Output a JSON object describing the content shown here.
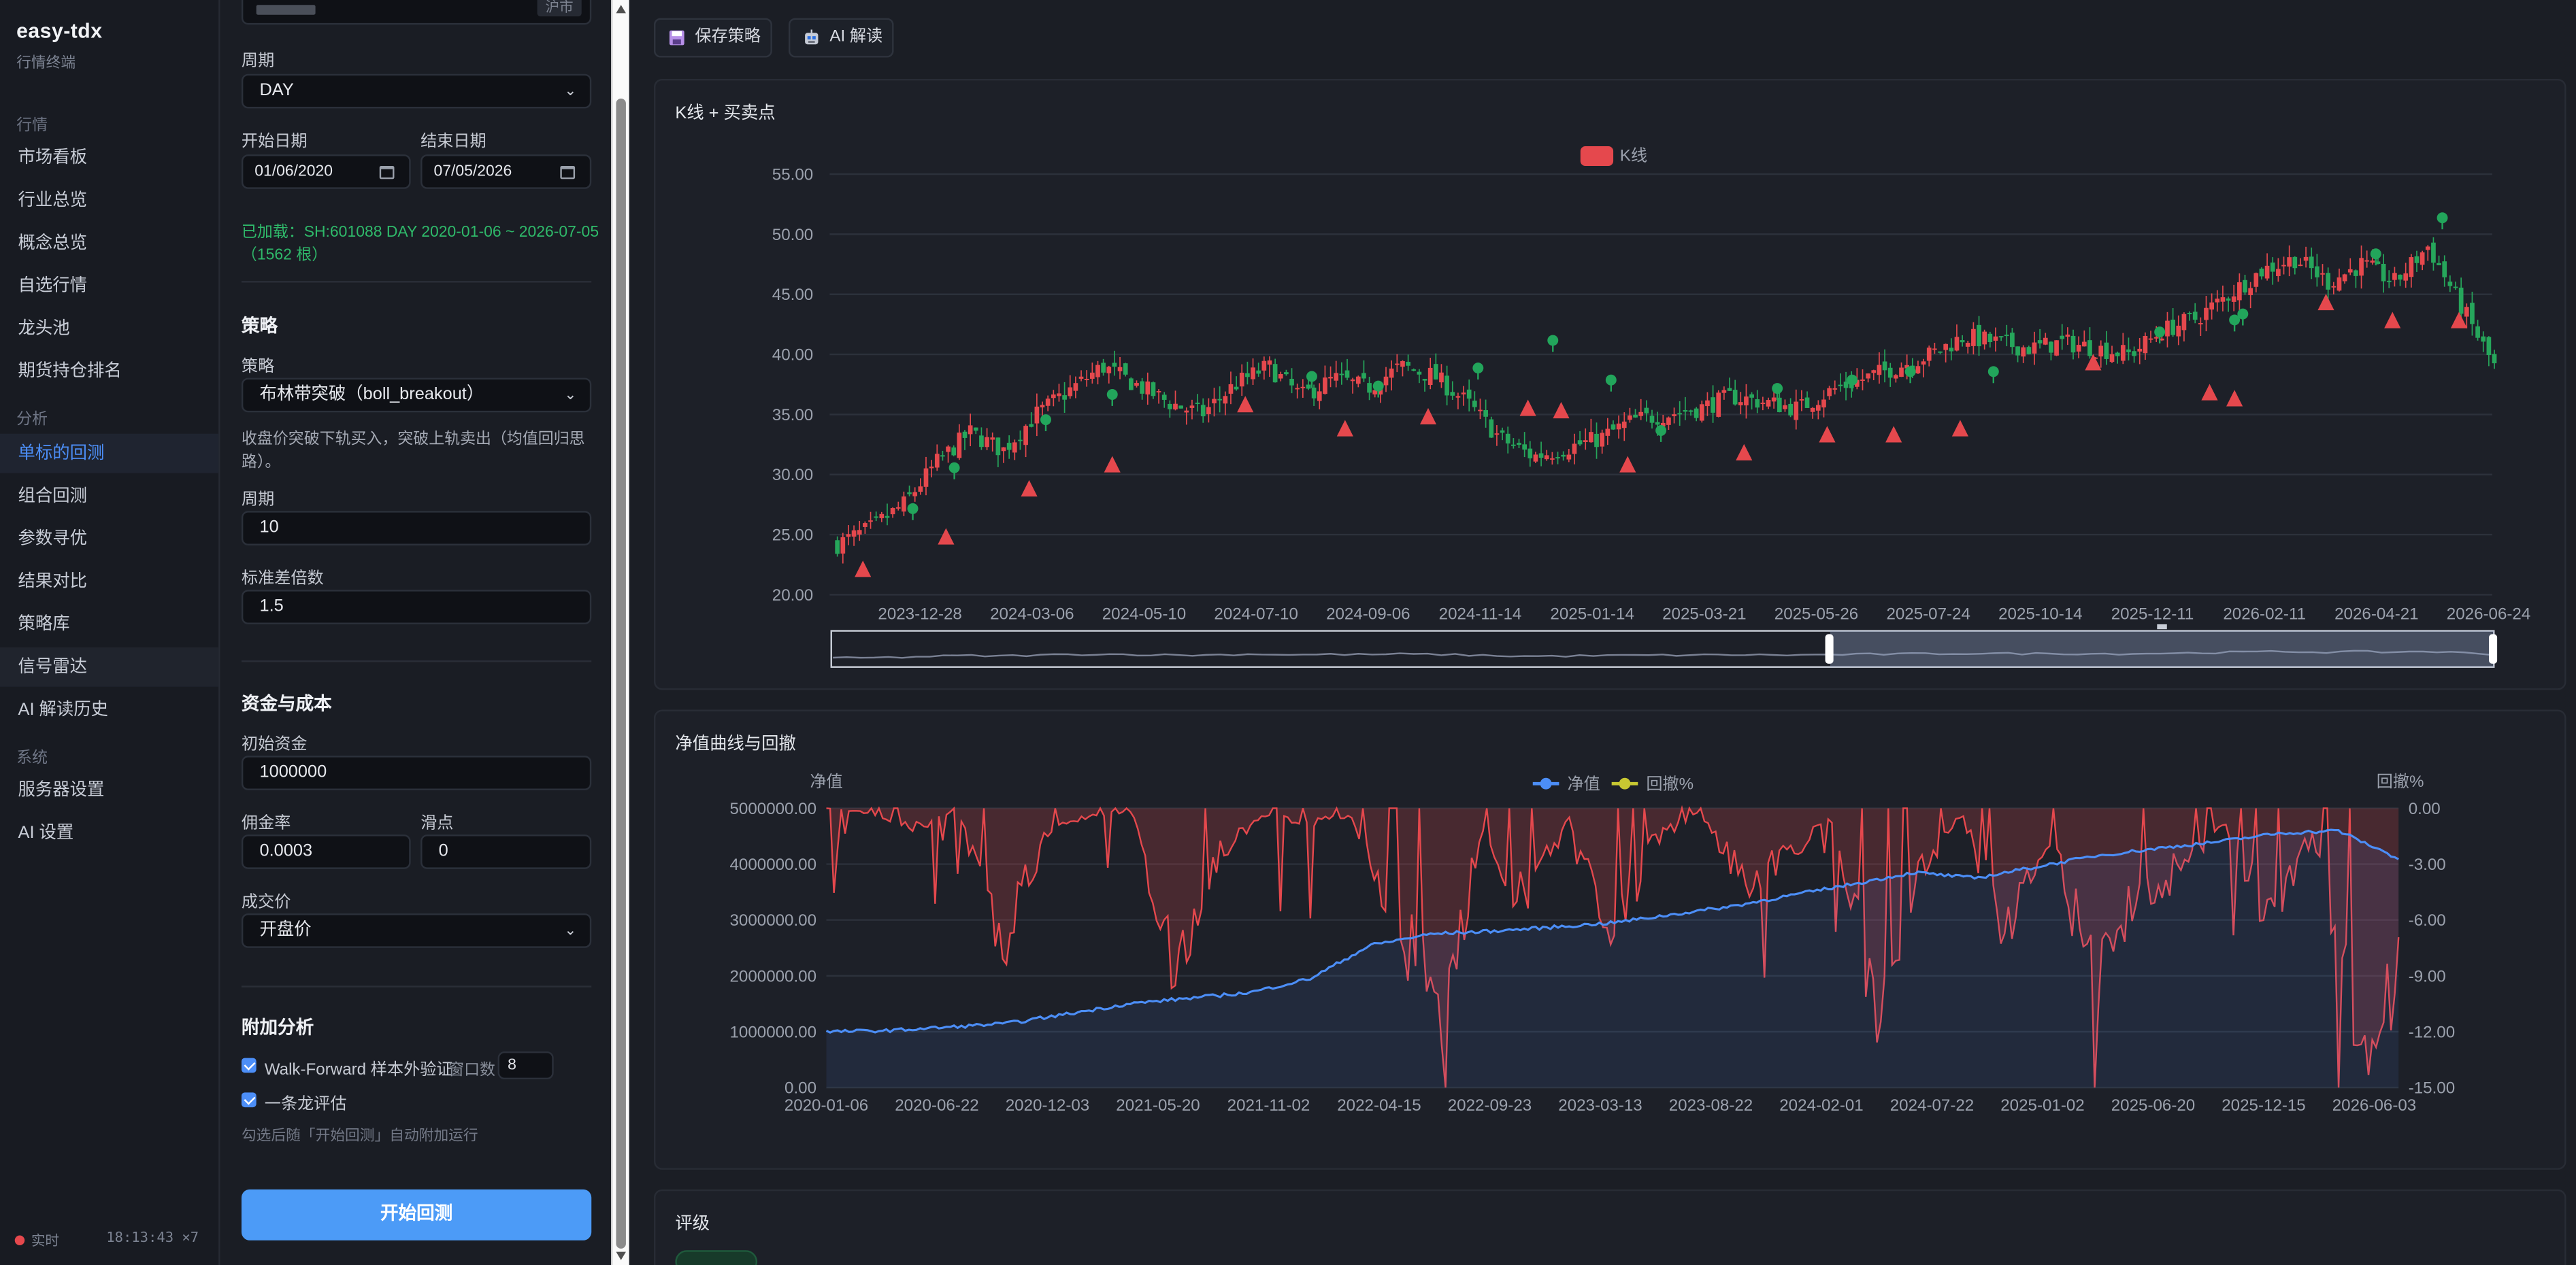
{
  "app": {
    "name": "easy-tdx",
    "subtitle": "行情终端"
  },
  "nav": {
    "sections": [
      {
        "label": "行情",
        "items": [
          "市场看板",
          "行业总览",
          "概念总览",
          "自选行情",
          "龙头池",
          "期货持仓排名"
        ]
      },
      {
        "label": "分析",
        "items": [
          "单标的回测",
          "组合回测",
          "参数寻优",
          "结果对比",
          "策略库",
          "信号雷达",
          "AI 解读历史"
        ]
      },
      {
        "label": "系统",
        "items": [
          "服务器设置",
          "AI 设置"
        ]
      }
    ],
    "active": "单标的回测",
    "status": {
      "live": "实时",
      "clock": "18:13:43 ×7"
    }
  },
  "form": {
    "market_tag": "沪市",
    "period_label": "周期",
    "period_value": "DAY",
    "start_label": "开始日期",
    "start_value": "01/06/2020",
    "end_label": "结束日期",
    "end_value": "07/05/2026",
    "loaded_line1": "已加载：SH:601088 DAY 2020-01-06 ~ 2026-07-05",
    "loaded_line2": "（1562 根）",
    "strategy_heading": "策略",
    "strategy_label": "策略",
    "strategy_value": "布林带突破（boll_breakout）",
    "strategy_desc1": "收盘价突破下轨买入，突破上轨卖出（均值回归思",
    "strategy_desc2": "路）。",
    "param_period_label": "周期",
    "param_period_value": "10",
    "param_std_label": "标准差倍数",
    "param_std_value": "1.5",
    "capital_heading": "资金与成本",
    "init_capital_label": "初始资金",
    "init_capital_value": "1000000",
    "commission_label": "佣金率",
    "commission_value": "0.0003",
    "slippage_label": "滑点",
    "slippage_value": "0",
    "fill_label": "成交价",
    "fill_value": "开盘价",
    "extra_heading": "附加分析",
    "wf_label": "Walk-Forward 样本外验证",
    "wf_window_label": "窗口数",
    "wf_window_value": "8",
    "dragon_label": "一条龙评估",
    "hint": "勾选后随「开始回测」自动附加运行",
    "run_button": "开始回测"
  },
  "toolbar": {
    "save": "保存策略",
    "ai": "AI 解读"
  },
  "kline_card": {
    "title": "K线 + 买卖点",
    "legend": "K线",
    "colors": {
      "up": "#e5484d",
      "down": "#26a65b",
      "buy": "#e5484d",
      "sell": "#22a55b"
    }
  },
  "equity_card": {
    "title": "净值曲线与回撤",
    "left_axis_name": "净值",
    "right_axis_name": "回撤%",
    "legend_equity": "净值",
    "legend_dd": "回撤%",
    "colors": {
      "equity": "#4c8ef7",
      "drawdown": "#e5484d",
      "dd_legend": "#c8c832"
    }
  },
  "rating_card": {
    "title": "评级"
  },
  "chart_data": [
    {
      "type": "candlestick",
      "title": "K线 + 买卖点",
      "legend": [
        "K线"
      ],
      "ylim": [
        20,
        55
      ],
      "yticks": [
        "55.00",
        "50.00",
        "45.00",
        "40.00",
        "35.00",
        "30.00",
        "25.00",
        "20.00"
      ],
      "xticks": [
        "2023-12-28",
        "2024-03-06",
        "2024-05-10",
        "2024-07-10",
        "2024-09-06",
        "2024-11-14",
        "2025-01-14",
        "2025-03-21",
        "2025-05-26",
        "2025-07-24",
        "2025-10-14",
        "2025-12-11",
        "2026-02-11",
        "2026-04-21",
        "2026-06-24"
      ],
      "close_series": [
        24.2,
        25.5,
        27.5,
        31,
        33.5,
        32,
        35,
        37,
        39,
        37.5,
        36,
        35,
        37.5,
        39,
        36.5,
        38,
        37.2,
        39,
        38.2,
        36,
        33,
        31.5,
        32.2,
        33,
        34.5,
        35,
        35.5,
        36.5,
        36,
        35.5,
        37,
        38,
        39,
        40,
        41.5,
        41,
        40.5,
        41,
        40.5,
        40,
        42,
        43,
        45,
        47,
        48,
        46,
        47.5,
        46,
        49,
        44,
        39
      ],
      "buy_points": [
        [
          0.02,
          23.8
        ],
        [
          0.07,
          26.5
        ],
        [
          0.12,
          30.5
        ],
        [
          0.17,
          32.5
        ],
        [
          0.25,
          37.5
        ],
        [
          0.31,
          35.5
        ],
        [
          0.36,
          36.5
        ],
        [
          0.42,
          37.2
        ],
        [
          0.44,
          37
        ],
        [
          0.48,
          32.5
        ],
        [
          0.55,
          33.5
        ],
        [
          0.6,
          35
        ],
        [
          0.64,
          35
        ],
        [
          0.68,
          35.5
        ],
        [
          0.76,
          41
        ],
        [
          0.83,
          38.5
        ],
        [
          0.845,
          38
        ],
        [
          0.9,
          46
        ],
        [
          0.94,
          44.5
        ],
        [
          0.98,
          44.5
        ]
      ],
      "sell_points": [
        [
          0.05,
          25.8
        ],
        [
          0.075,
          29.2
        ],
        [
          0.13,
          33.2
        ],
        [
          0.17,
          35.3
        ],
        [
          0.29,
          36.8
        ],
        [
          0.33,
          36
        ],
        [
          0.39,
          37.5
        ],
        [
          0.435,
          39.8
        ],
        [
          0.47,
          36.5
        ],
        [
          0.5,
          32.3
        ],
        [
          0.57,
          35.8
        ],
        [
          0.615,
          36.5
        ],
        [
          0.65,
          37.2
        ],
        [
          0.7,
          37.2
        ],
        [
          0.8,
          40.5
        ],
        [
          0.845,
          41.5
        ],
        [
          0.85,
          42
        ],
        [
          0.93,
          47
        ],
        [
          0.97,
          50
        ]
      ]
    },
    {
      "type": "line",
      "title": "净值曲线与回撤",
      "legend": [
        "净值",
        "回撤%"
      ],
      "left_ylim": [
        0,
        5000000
      ],
      "left_yticks": [
        "5000000.00",
        "4000000.00",
        "3000000.00",
        "2000000.00",
        "1000000.00",
        "0.00"
      ],
      "right_ylim": [
        -15,
        0
      ],
      "right_yticks": [
        "0.00",
        "-3.00",
        "-6.00",
        "-9.00",
        "-12.00",
        "-15.00"
      ],
      "xticks": [
        "2020-01-06",
        "2020-06-22",
        "2020-12-03",
        "2021-05-20",
        "2021-11-02",
        "2022-04-15",
        "2022-09-23",
        "2023-03-13",
        "2023-08-22",
        "2024-02-01",
        "2024-07-22",
        "2025-01-02",
        "2025-06-20",
        "2025-12-15",
        "2026-06-03"
      ],
      "series": [
        {
          "name": "净值",
          "values": [
            1000000,
            1020000,
            1080000,
            1150000,
            1320000,
            1500000,
            1600000,
            1700000,
            1950000,
            2550000,
            2750000,
            2800000,
            2870000,
            2950000,
            3100000,
            3250000,
            3450000,
            3650000,
            3850000,
            3750000,
            3950000,
            4150000,
            4280000,
            4400000,
            4550000,
            4600000,
            4100000
          ]
        },
        {
          "name": "回撤%",
          "values": [
            0,
            -0.3,
            -1.2,
            -0.1,
            -9,
            -2,
            -0.5,
            -0.2,
            -11,
            -3,
            -0.4,
            -1,
            -0.5,
            -7,
            -14.5,
            -2,
            -6.5,
            -0.7,
            -8,
            -2,
            -0.3,
            -5,
            -3,
            -0.8,
            -13,
            -4,
            -0.5,
            -8,
            -2,
            -11,
            -6,
            -4,
            -1,
            -7,
            -2,
            -15,
            -12
          ]
        }
      ]
    }
  ]
}
